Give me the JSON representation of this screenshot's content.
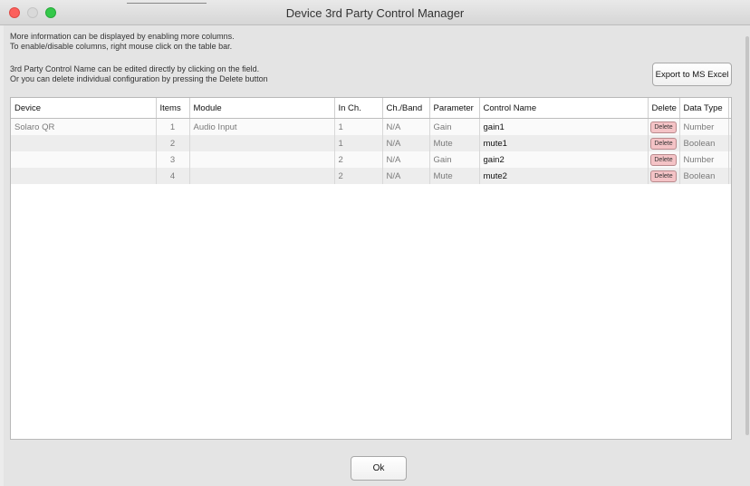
{
  "window": {
    "title": "Device 3rd Party Control Manager"
  },
  "info": {
    "line1": "More information can be displayed by enabling more columns.",
    "line2": "To enable/disable columns, right mouse click on the table bar.",
    "line3": "3rd Party Control Name can be edited directly by clicking on the field.",
    "line4": "Or you can delete individual configuration by pressing the Delete button"
  },
  "export_button": "Export to MS Excel",
  "table": {
    "headers": [
      "Device",
      "Items",
      "Module",
      "In Ch.",
      "Ch./Band",
      "Parameter",
      "Control Name",
      "Delete",
      "Data Type"
    ],
    "rows": [
      {
        "device": "Solaro QR",
        "items": "1",
        "module": "Audio Input",
        "in_ch": "1",
        "ch_band": "N/A",
        "parameter": "Gain",
        "control_name": "gain1",
        "delete": "Delete",
        "data_type": "Number"
      },
      {
        "device": "",
        "items": "2",
        "module": "",
        "in_ch": "1",
        "ch_band": "N/A",
        "parameter": "Mute",
        "control_name": "mute1",
        "delete": "Delete",
        "data_type": "Boolean"
      },
      {
        "device": "",
        "items": "3",
        "module": "",
        "in_ch": "2",
        "ch_band": "N/A",
        "parameter": "Gain",
        "control_name": "gain2",
        "delete": "Delete",
        "data_type": "Number"
      },
      {
        "device": "",
        "items": "4",
        "module": "",
        "in_ch": "2",
        "ch_band": "N/A",
        "parameter": "Mute",
        "control_name": "mute2",
        "delete": "Delete",
        "data_type": "Boolean"
      }
    ]
  },
  "ok_button": "Ok",
  "colors": {
    "close": "#fc605c",
    "minimize": "#d9d9d9",
    "maximize": "#34c84a",
    "delete_button": "#f4c3c6"
  }
}
